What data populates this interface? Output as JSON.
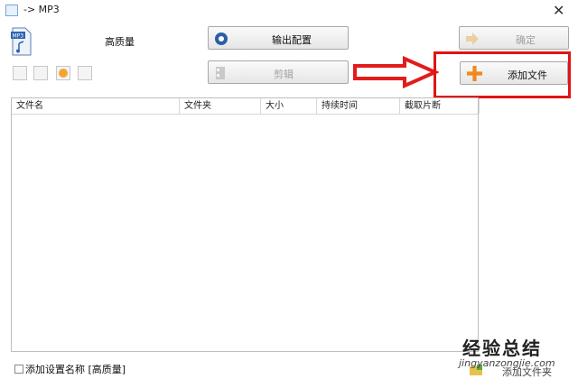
{
  "window": {
    "title": "-> MP3",
    "close_glyph": "✕"
  },
  "profile": {
    "name": "高质量",
    "icon": "mp3-file-icon"
  },
  "toolbar": {
    "output_config_label": "输出配置",
    "confirm_label": "确定",
    "clip_label": "剪辑",
    "add_file_label": "添加文件"
  },
  "file_table": {
    "columns": [
      "文件名",
      "文件夹",
      "大小",
      "持续时间",
      "截取片断"
    ],
    "rows": []
  },
  "footer": {
    "add_setting_checkbox_label": "添加设置名称 [高质量]",
    "add_folder_label": "添加文件夹"
  },
  "watermark": {
    "line1": "经验总结",
    "line2": "jingyanzongjie.com"
  },
  "colors": {
    "highlight_red": "#e01414",
    "arrow_red": "#e31b1b",
    "plus_orange": "#f08a1c"
  }
}
